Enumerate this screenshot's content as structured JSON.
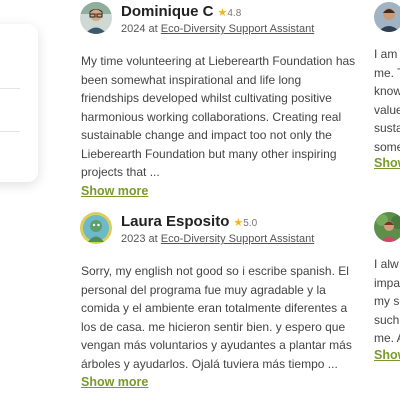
{
  "reviews": [
    {
      "name": "Dominique C",
      "rating": "4.8",
      "year": "2024",
      "at_label": "at",
      "role": "Eco-Diversity Support Assistant",
      "text": "My time volunteering at Lieberearth Foundation has been somewhat inspirational and life long friendships developed whilst cultivating positive harmonious working collaborations. Creating real sustainable change and impact too not only the Lieberearth Foundation but many other inspiring projects that ...",
      "more_label": "Show more"
    },
    {
      "name": "Laura Esposito",
      "rating": "5.0",
      "year": "2023",
      "at_label": "at",
      "role": "Eco-Diversity Support Assistant",
      "text": "Sorry, my english not good so i escribe spanish. El personal del programa fue muy agradable y la comida y el ambiente eran totalmente diferentes a los de casa. me hicieron sentir bien. y espero que vengan más voluntarios y ayudantes a plantar más árboles y ayudarlos. Ojalá tuviera más tiempo ...",
      "more_label": "Show more"
    }
  ],
  "right_column": [
    {
      "lines": [
        "I am",
        "me. T",
        "know",
        "value",
        "susta",
        "some"
      ],
      "more_label": "Show"
    },
    {
      "lines": [
        "I alw",
        "impa",
        "my so",
        "such",
        "me. A"
      ],
      "more_label": "Show"
    }
  ],
  "colors": {
    "accent": "#7a9a2b",
    "star": "#f3b51b",
    "text": "#444444",
    "heading": "#222222"
  },
  "icons": {
    "rating": "star-icon"
  }
}
